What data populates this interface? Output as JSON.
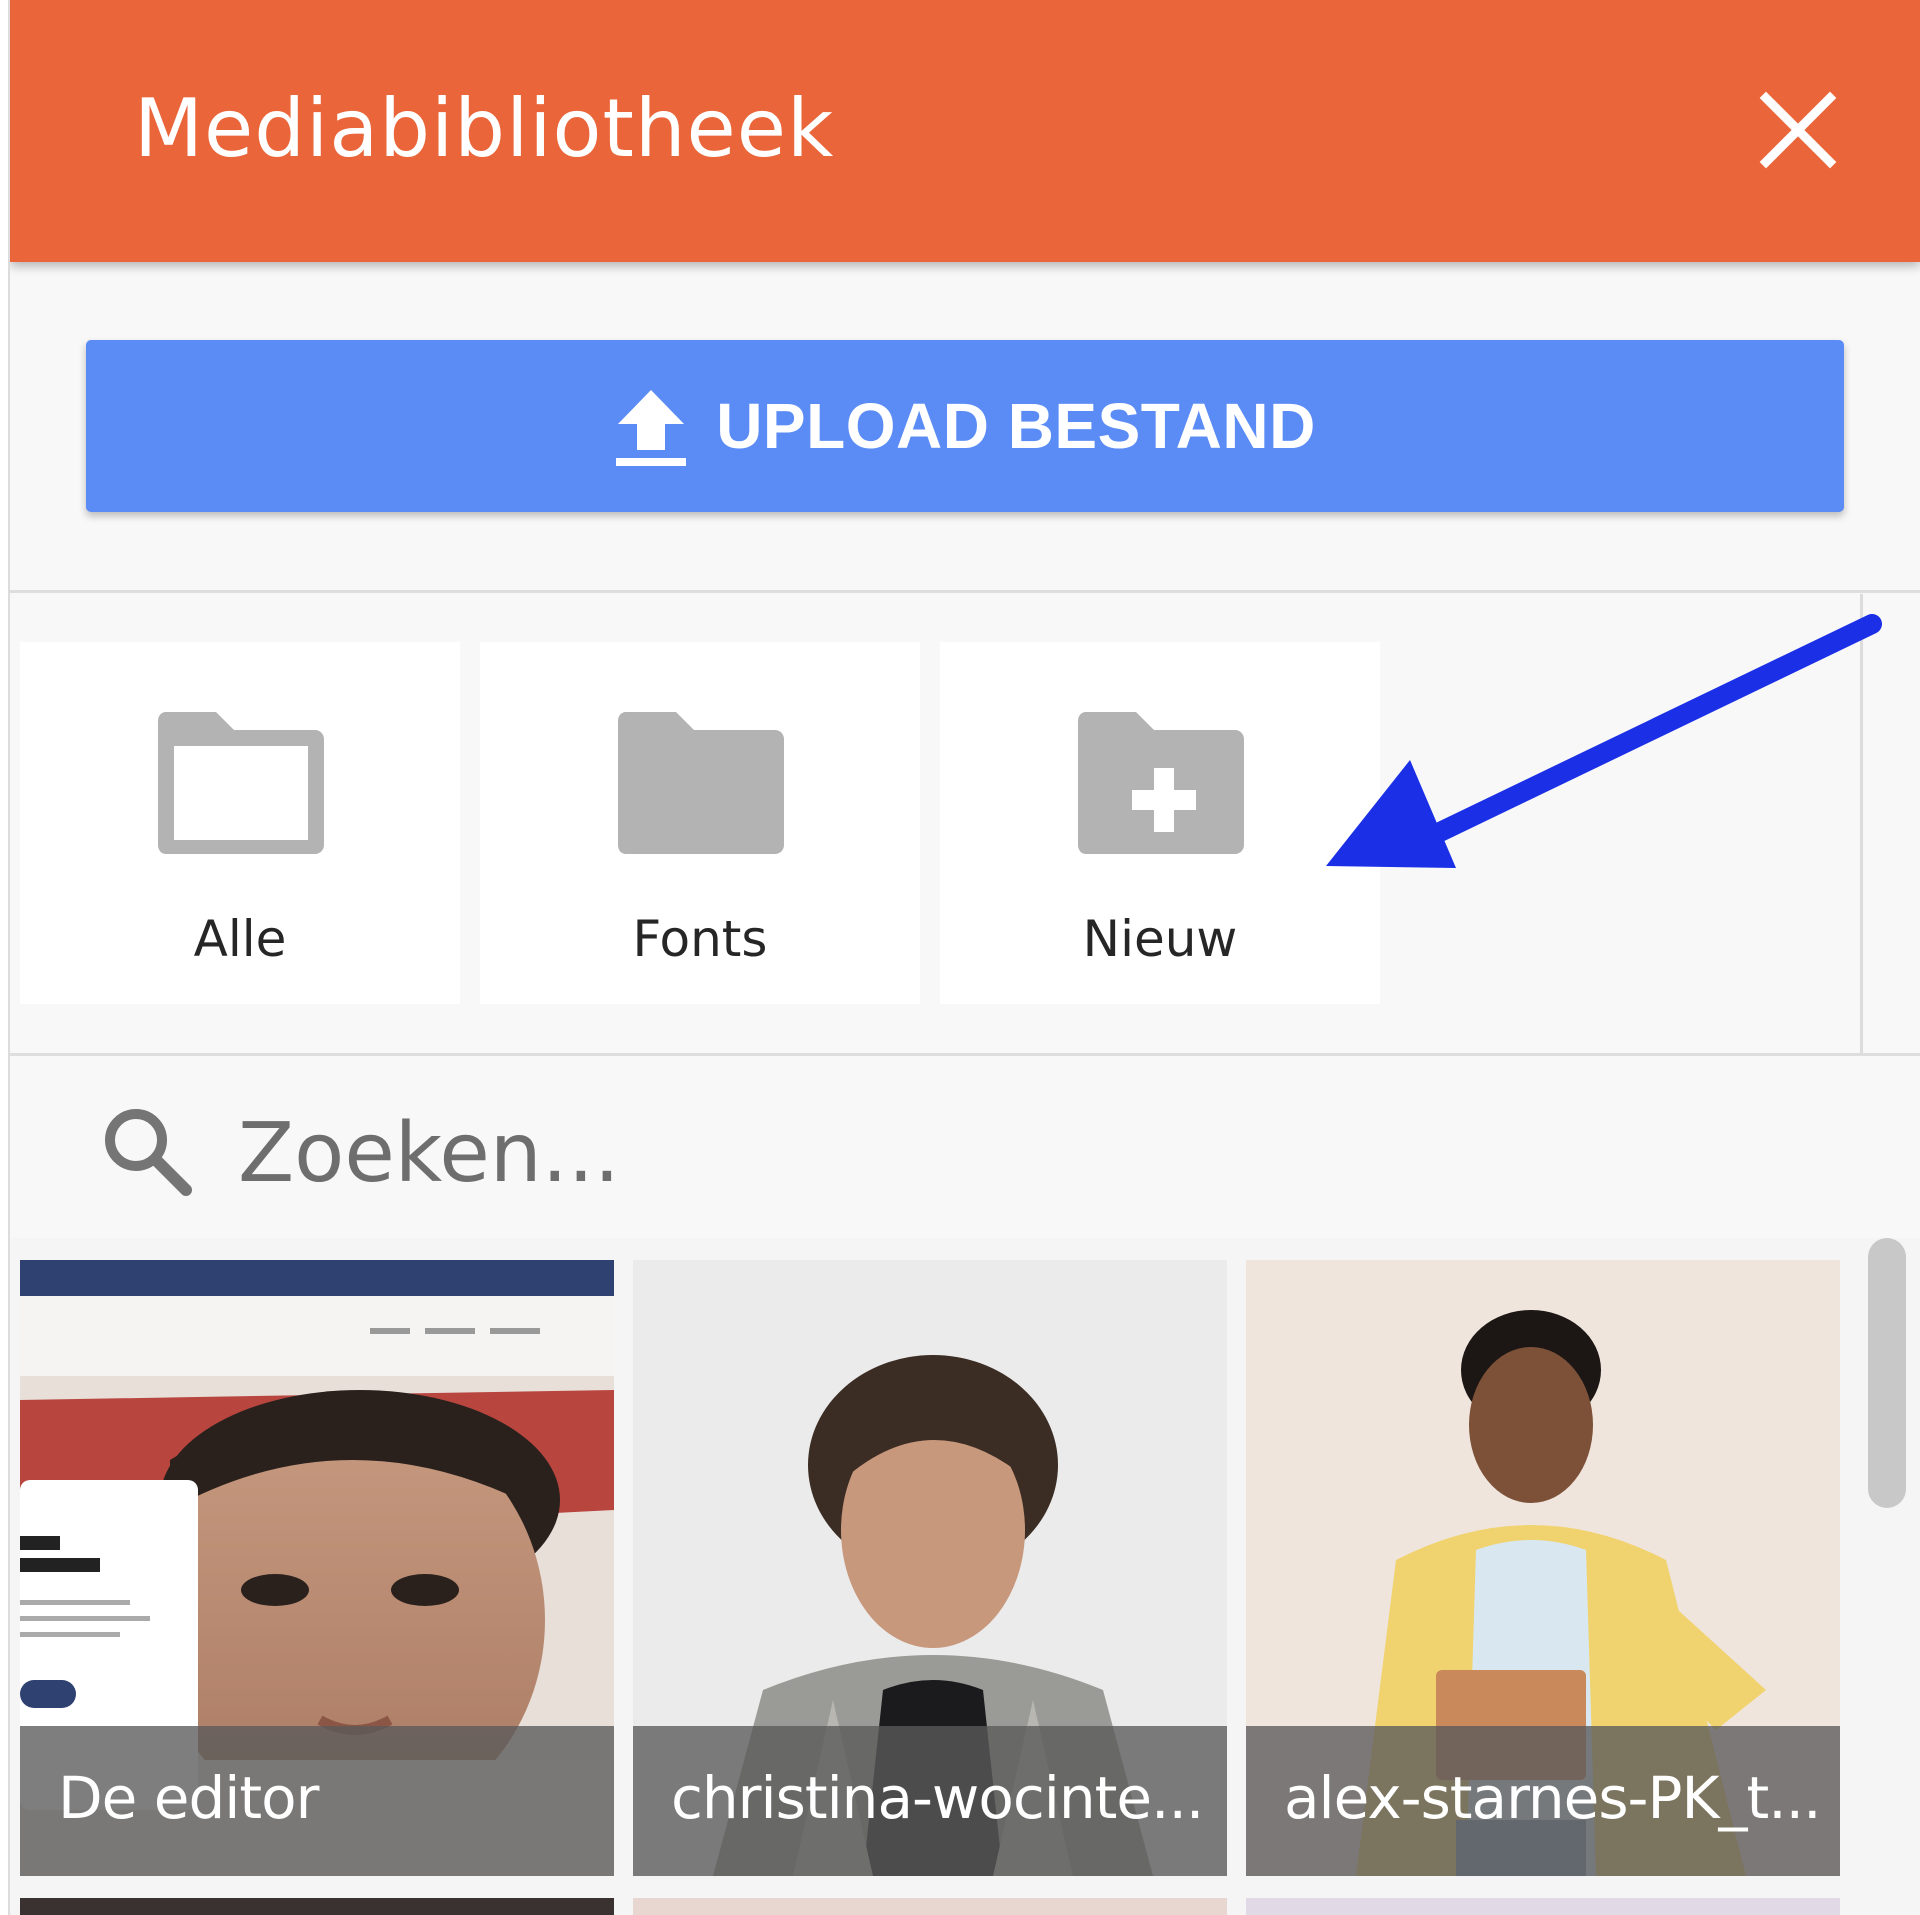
{
  "header": {
    "title": "Mediabibliotheek",
    "close_icon": "close-icon"
  },
  "upload": {
    "label": "UPLOAD BESTAND",
    "icon": "upload-icon"
  },
  "folders": [
    {
      "label": "Alle",
      "icon": "folder-outline-icon"
    },
    {
      "label": "Fonts",
      "icon": "folder-filled-icon"
    },
    {
      "label": "Nieuw",
      "icon": "folder-add-icon"
    }
  ],
  "search": {
    "placeholder": "Zoeken...",
    "icon": "search-icon"
  },
  "media": [
    {
      "caption": "De editor"
    },
    {
      "caption": "christina-wocinte..."
    },
    {
      "caption": "alex-starnes-PK_t..."
    }
  ],
  "colors": {
    "header": "#ea6539",
    "upload": "#5b8cf5",
    "annotation_arrow": "#1a2fe6",
    "icon_gray": "#b3b3b3"
  }
}
